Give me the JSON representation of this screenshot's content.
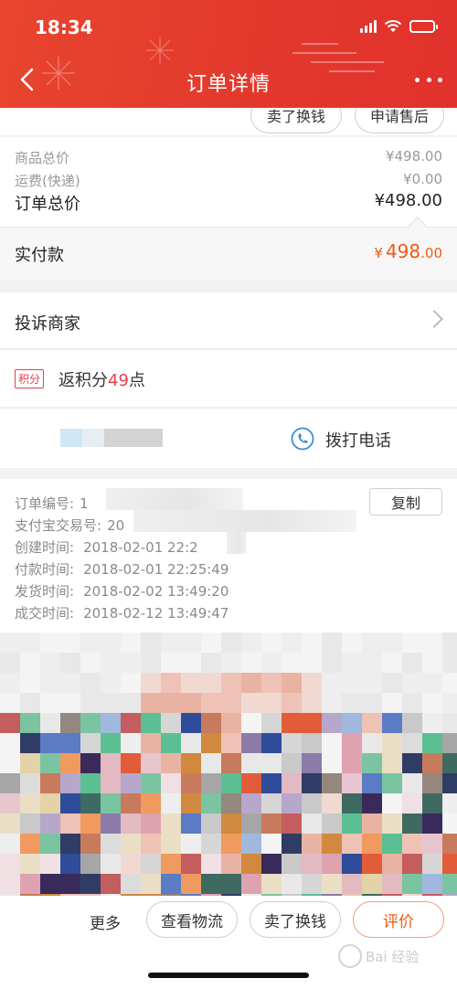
{
  "status_bar": {
    "time": "18:34",
    "battery_level": 0.45
  },
  "nav": {
    "title": "订单详情",
    "back_icon": "back-arrow-icon",
    "more_icon": "more-dots-icon"
  },
  "top_actions": {
    "exchange_label": "卖了换钱",
    "after_sale_label": "申请售后"
  },
  "price_summary": {
    "goods_total_label": "商品总价",
    "goods_total_value": "¥498.00",
    "shipping_label": "运费(快递)",
    "shipping_value": "¥0.00",
    "order_total_label": "订单总价",
    "order_total_value": "¥498.00"
  },
  "paid": {
    "label": "实付款",
    "currency": "¥",
    "integer": "498",
    "decimal": ".00",
    "color": "#f05a0e"
  },
  "complain": {
    "label": "投诉商家"
  },
  "points": {
    "badge": "积分",
    "prefix": "返积分",
    "value": "49",
    "suffix": "点",
    "color": "#e2404b"
  },
  "contact": {
    "call_label": "拨打电话",
    "phone_icon": "phone-icon"
  },
  "order_info": {
    "copy_label": "复制",
    "order_no_label": "订单编号:",
    "order_no_value": "1",
    "alipay_label": "支付宝交易号:",
    "alipay_value": "20",
    "created_label": "创建时间:",
    "created_value": "2018-02-01 22:2",
    "paid_label": "付款时间:",
    "paid_value": "2018-02-01 22:25:49",
    "shipped_label": "发货时间:",
    "shipped_value": "2018-02-02 13:49:20",
    "completed_label": "成交时间:",
    "completed_value": "2018-02-12 13:49:47"
  },
  "bottom_bar": {
    "more_label": "更多",
    "logistics_label": "查看物流",
    "exchange_label": "卖了换钱",
    "review_label": "评价"
  },
  "watermark": {
    "text": "Bai 经验"
  }
}
